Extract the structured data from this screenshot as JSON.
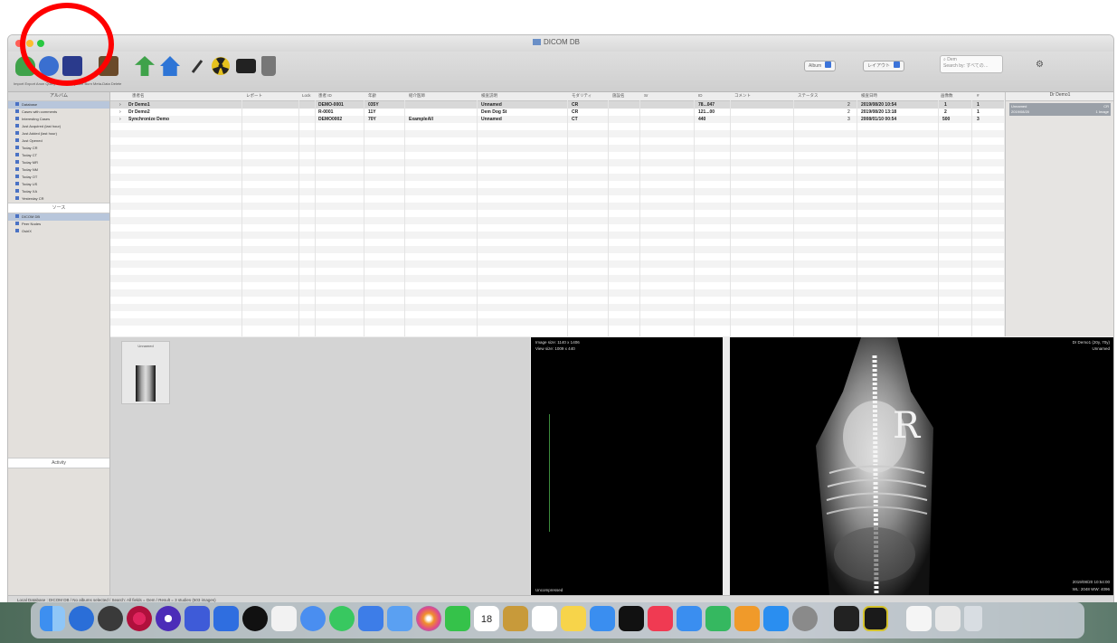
{
  "window": {
    "title": "DICOM DB"
  },
  "toolbar": {
    "buttons": [
      {
        "label": "Import",
        "color": "#3fa24a"
      },
      {
        "label": "Export",
        "color": "#3a6fd0"
      },
      {
        "label": "Anon",
        "color": "#2a3a8c"
      },
      {
        "label": "Query",
        "color": "#6a4a2a"
      },
      {
        "label": "Send",
        "color": "#3fa24a"
      },
      {
        "label": "Burn",
        "color": "#2e75d6"
      },
      {
        "label": "Tools",
        "color": "#333"
      },
      {
        "label": "Anonymize",
        "color": "#d9c02a"
      },
      {
        "label": "Meta",
        "color": "#222"
      },
      {
        "label": "Delete",
        "color": "#777"
      }
    ],
    "labels_strip": "Import  Export  Anon  Query  Send  Anonymize  Burn  Meta-Data  Delete",
    "albums_btn": "Album",
    "layout_btn": "レイアウト",
    "search_placeholder": "Dem",
    "search_sub": "Search by: すべての…"
  },
  "sidebar": {
    "header": "アルバム",
    "items": [
      "Database",
      "Cases with comments",
      "Interesting Cases",
      "Just Acquired (last hour)",
      "Just Added (last hour)",
      "Just Opened",
      "Today CR",
      "Today CT",
      "Today MR",
      "Today NM",
      "Today OT",
      "Today US",
      "Today XA",
      "Yesterday CR"
    ],
    "sources_header": "ソース",
    "sources": [
      "DICOM DB",
      "Peer Nodes",
      "OsiriX"
    ],
    "activity": "Activity"
  },
  "table": {
    "columns": [
      "患者名",
      "レポート",
      "Lock",
      "患者 ID",
      "年齢",
      "紹介医師",
      "検査説明",
      "モダリティ",
      "施設名",
      "Sr",
      "ID",
      "コメント",
      "ステータス",
      "検査日時",
      "画像数",
      "#"
    ],
    "rows": [
      {
        "name": "Dr Demo1",
        "id": "DEMO-0001",
        "age": "035Y",
        "desc": "Unnamed",
        "mod": "CR",
        "acc": "78...047",
        "num": "2",
        "date": "2019/08/20 10:54",
        "images": "1",
        "count": "1"
      },
      {
        "name": "Dr Demo2",
        "id": "R-0001",
        "age": "11Y",
        "desc": "Dem Dog St",
        "mod": "CR",
        "acc": "121...00",
        "num": "2",
        "date": "2019/08/20 13:18",
        "images": "2",
        "count": "1"
      },
      {
        "name": "Synchronize Demo",
        "id": "DEMO0002",
        "age": "70Y",
        "ref": "ExampleAll",
        "desc": "Unnamed",
        "mod": "CT",
        "acc": "440",
        "num": "3",
        "date": "2008/01/10 00:54",
        "images": "500",
        "count": "3"
      }
    ]
  },
  "rightpanel": {
    "header": "Dr Demo1",
    "line1": "Unnamed",
    "line1b": "CR",
    "line2": "2019/08/20",
    "line2b": "1 Image"
  },
  "thumb": {
    "label": "Unnamed"
  },
  "viewer1": {
    "info1": "Image size: 1140 x 1406",
    "info2": "View size: 1009 x 440",
    "bottom": "Uncompressed"
  },
  "viewer2": {
    "info_tr": "Dr Demo1 (20y, 70y)",
    "info_tr2": "Unnamed",
    "marker": "R",
    "info_br": "2019/08/20 10:54:00",
    "wlww": "WL: 2048 WW: 4096"
  },
  "status": {
    "text": "Local Database : DICOM DB / No albums selected / Search: All fields = Dem / Result = 3 studies (503 images)"
  },
  "dock": {
    "icons": [
      "finder-icon",
      "launchpad-icon",
      "safari-icon",
      "chrome-icon",
      "music-icon",
      "messages-icon",
      "mail-icon",
      "maps-icon",
      "photos-icon",
      "facetime-icon",
      "calendar-icon",
      "reminders-icon",
      "notes-icon",
      "tv-icon",
      "music-app-icon",
      "podcasts-icon",
      "appstore-icon",
      "settings-icon",
      "terminal-icon",
      "preview-icon",
      "trash-icon"
    ],
    "calendar_day": "18"
  }
}
